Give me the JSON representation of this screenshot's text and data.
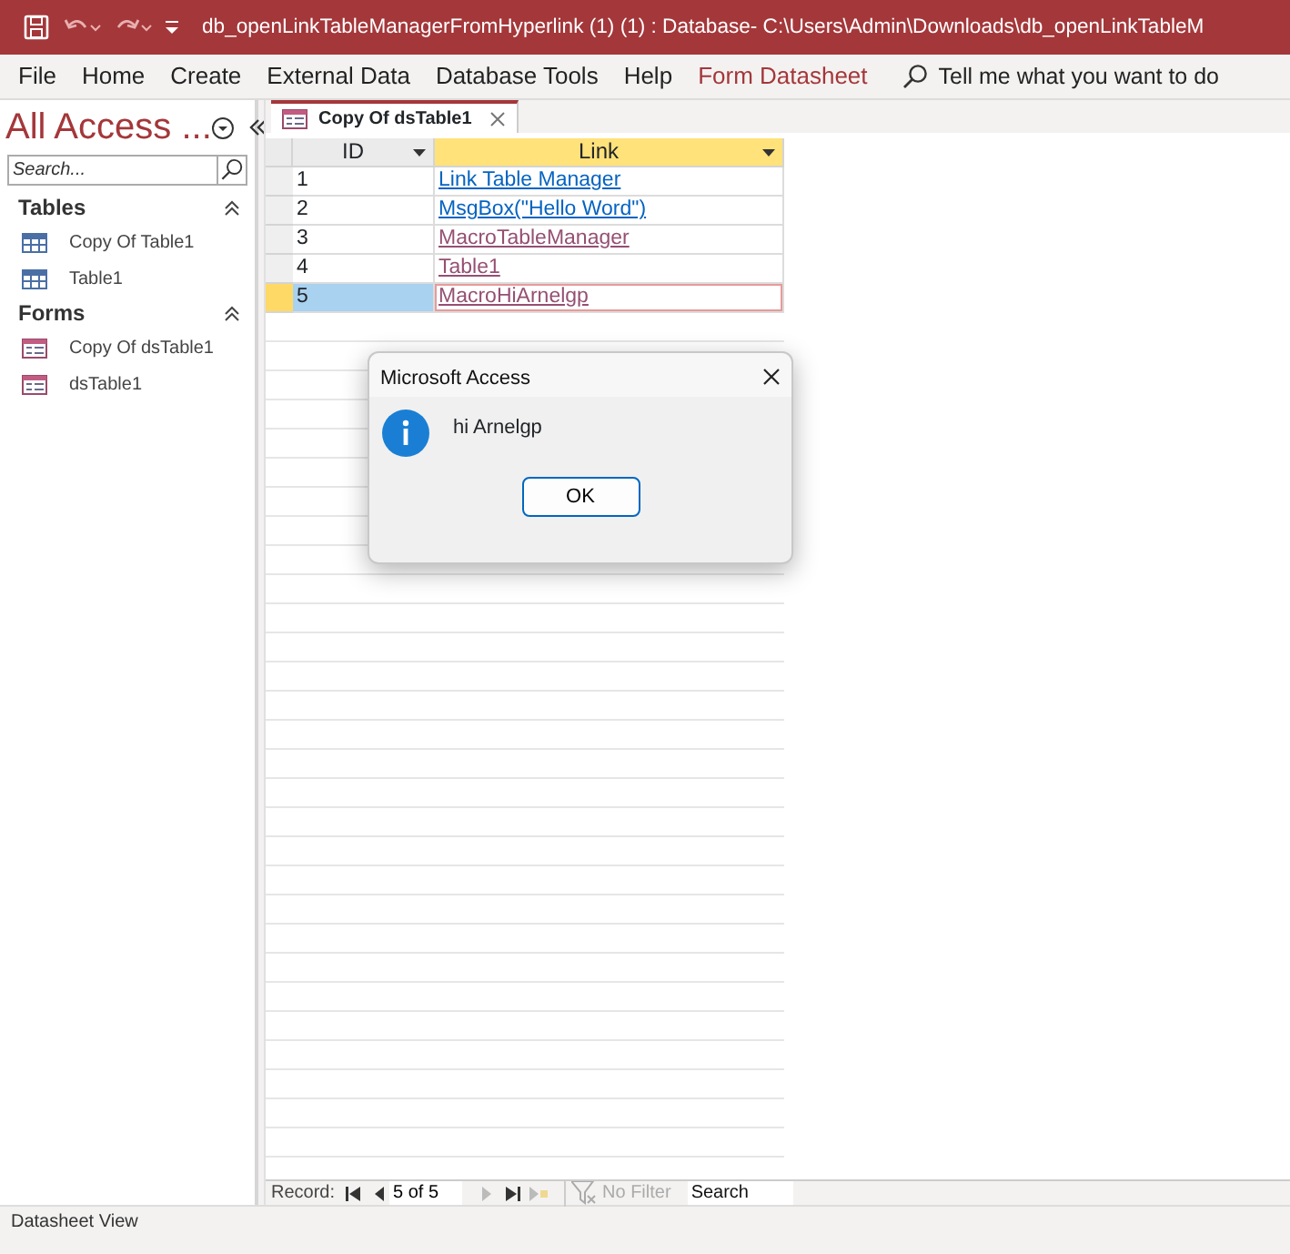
{
  "window": {
    "title": "db_openLinkTableManagerFromHyperlink (1) (1) : Database- C:\\Users\\Admin\\Downloads\\db_openLinkTableM"
  },
  "ribbon_tabs": [
    {
      "label": "File",
      "kind": "standard"
    },
    {
      "label": "Home",
      "kind": "standard"
    },
    {
      "label": "Create",
      "kind": "standard"
    },
    {
      "label": "External Data",
      "kind": "standard"
    },
    {
      "label": "Database Tools",
      "kind": "standard"
    },
    {
      "label": "Help",
      "kind": "standard"
    },
    {
      "label": "Form Datasheet",
      "kind": "contextual"
    }
  ],
  "tell_me": {
    "placeholder": "Tell me what you want to do"
  },
  "nav_pane": {
    "title": "All Access ...",
    "search": {
      "placeholder": "Search..."
    },
    "groups": [
      {
        "label": "Tables",
        "expanded": true,
        "items": [
          {
            "label": "Copy Of Table1",
            "kind": "table"
          },
          {
            "label": "Table1",
            "kind": "table"
          }
        ]
      },
      {
        "label": "Forms",
        "expanded": true,
        "items": [
          {
            "label": "Copy Of dsTable1",
            "kind": "form"
          },
          {
            "label": "dsTable1",
            "kind": "form"
          }
        ]
      }
    ]
  },
  "document_tabs": [
    {
      "label": "Copy Of dsTable1",
      "selected": true
    }
  ],
  "datasheet": {
    "columns": [
      {
        "label": "ID",
        "selected": false
      },
      {
        "label": "Link",
        "selected": true
      }
    ],
    "rows": [
      {
        "id": "1",
        "link": "Link Table Manager",
        "visited": false,
        "selected": false
      },
      {
        "id": "2",
        "link": "MsgBox(\"Hello Word\")",
        "visited": false,
        "selected": false
      },
      {
        "id": "3",
        "link": "MacroTableManager",
        "visited": true,
        "selected": false
      },
      {
        "id": "4",
        "link": "Table1",
        "visited": true,
        "selected": false
      },
      {
        "id": "5",
        "link": "MacroHiArnelgp",
        "visited": true,
        "selected": true
      }
    ]
  },
  "record_nav": {
    "label": "Record:",
    "position": "5 of 5",
    "filter": "No Filter",
    "search": {
      "placeholder": "Search"
    }
  },
  "dialog": {
    "title": "Microsoft Access",
    "message": "hi Arnelgp",
    "buttons": [
      "OK"
    ]
  },
  "status_bar": {
    "text": "Datasheet View"
  }
}
